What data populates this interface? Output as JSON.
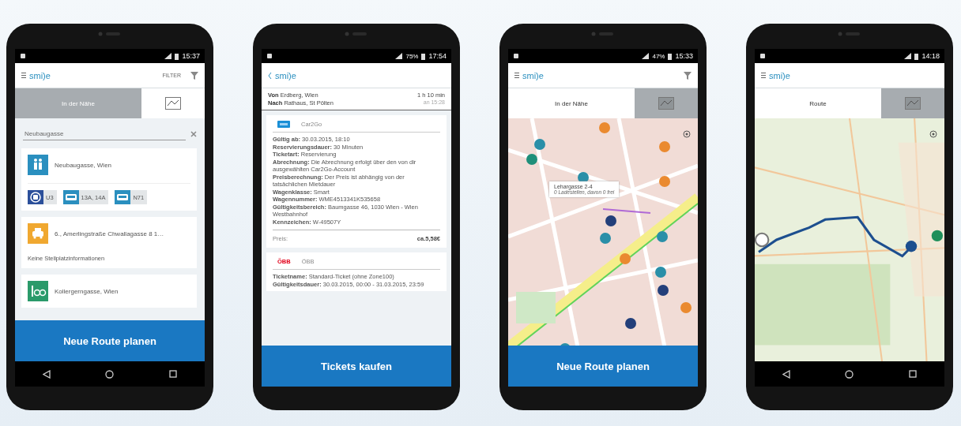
{
  "phones": [
    {
      "status_time": "15:37",
      "header": {
        "leading": [
          {
            "kind": "menu"
          }
        ],
        "logo": "smi)e",
        "actions": [
          {
            "kind": "filter",
            "label": "FILTER"
          }
        ]
      },
      "tabs": [
        {
          "kind": "text",
          "label": "In der Nähe",
          "selected": true
        },
        {
          "kind": "map",
          "selected": false
        }
      ],
      "content": {
        "kind": "list",
        "search_value": "Neubaugasse",
        "cards": [
          {
            "kind": "toilet",
            "color": "#2a8fbf",
            "title": "Neubaugasse, Wien",
            "lines": [
              {
                "kind": "metro",
                "color": "#2b4f9a",
                "label": "U3"
              },
              {
                "kind": "bus",
                "color": "#2a8fbf",
                "label": "13A, 14A"
              },
              {
                "kind": "bus",
                "color": "#2a8fbf",
                "label": "N71"
              }
            ]
          },
          {
            "kind": "taxi",
            "color": "#f0a830",
            "title": "6., Amerlingstraße Chwallagasse 8 1…",
            "subtitle": "Keine Stellplatzinformationen"
          },
          {
            "kind": "bike",
            "color": "#2a9a6a",
            "title": "Kollergerngasse, Wien"
          }
        ]
      },
      "action_button": "Neue Route planen",
      "nav_keys": [
        {
          "kind": "back"
        },
        {
          "kind": "home"
        },
        {
          "kind": "recents"
        }
      ]
    },
    {
      "status_time": "17:54",
      "battery_label": "75%",
      "header": {
        "leading": [
          {
            "kind": "back"
          }
        ],
        "logo": "smi)e"
      },
      "content": {
        "kind": "tickets",
        "route": {
          "from_label": "Von",
          "from": "Erdberg, Wien",
          "to_label": "Nach",
          "to": "Rathaus, St Pölten",
          "duration": "1 h 10 min",
          "arrival": "an 15:28"
        },
        "tickets": [
          {
            "kind": "car2go",
            "provider": "Car2Go",
            "details": [
              "**Gültig ab:** 30.03.2015, 18:10",
              "**Reservierungsdauer:** 30 Minuten",
              "**Ticketart:** Reservierung",
              "**Abrechnung:** Die Abrechnung erfolgt über den von dir ausgewählten Car2Go-Account",
              "**Preisberechnung:** Der Preis ist abhängig von der tatsächlichen Mietdauer",
              "**Wagenklasse:** Smart",
              "**Wagennummer:** WME4513341K535658",
              "**Gültigkeitsbereich:** Baumgasse 46, 1030 Wien - Wien Westbahnhof",
              "**Kennzeichen:** W-49507Y"
            ],
            "price_label": "Preis:",
            "price": "ca.5,58€"
          },
          {
            "kind": "oebb",
            "logo_text": "ÖBB",
            "provider": "ÖBB",
            "details": [
              "**Ticketname:** Standard-Ticket (ohne Zone100)",
              "**Gültigkeitsdauer:** 30.03.2015, 00:00 - 31.03.2015, 23:59"
            ]
          }
        ]
      },
      "action_button": "Tickets kaufen"
    },
    {
      "status_time": "15:33",
      "battery_label": "47%",
      "header": {
        "leading": [
          {
            "kind": "menu"
          }
        ],
        "logo": "smi)e",
        "actions": [
          {
            "kind": "filter"
          }
        ]
      },
      "tabs": [
        {
          "kind": "text",
          "label": "In der Nähe",
          "selected": false
        },
        {
          "kind": "map",
          "selected": true
        }
      ],
      "content": {
        "kind": "city_map",
        "popup": {
          "title": "Lehargasse 2-4",
          "subtitle": "0 Ladestellen, davon 0 frei"
        }
      },
      "action_button": "Neue Route planen"
    },
    {
      "status_time": "14:18",
      "header": {
        "leading": [
          {
            "kind": "menu"
          }
        ],
        "logo": "smi)e"
      },
      "tabs": [
        {
          "kind": "text",
          "label": "Route",
          "selected": false
        },
        {
          "kind": "map",
          "selected": true
        }
      ],
      "content": {
        "kind": "region_map"
      },
      "nav_keys": [
        {
          "kind": "back"
        },
        {
          "kind": "home"
        },
        {
          "kind": "recents"
        }
      ]
    }
  ]
}
